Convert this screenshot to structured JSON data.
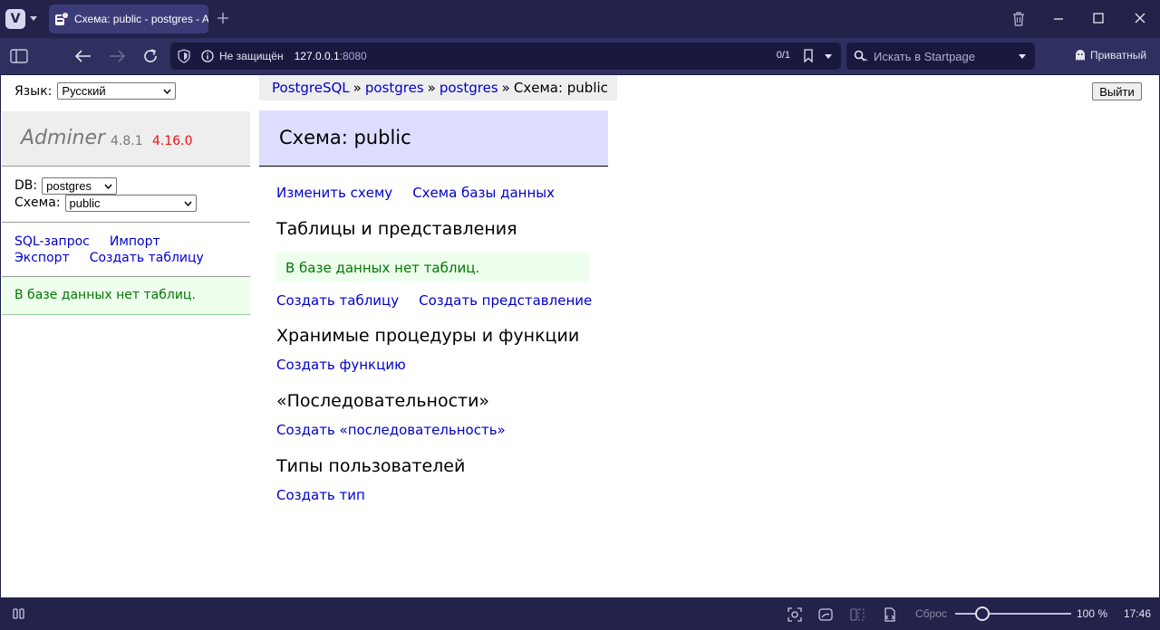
{
  "browser": {
    "tab_title": "Схема: public - postgres - Adminer",
    "address": {
      "security_label": "Не защищён",
      "host": "127.0.0.1",
      "port": ":8080",
      "match_counter": "0/1"
    },
    "search_placeholder": "Искать в Startpage",
    "private_label": "Приватный",
    "status": {
      "reset_label": "Сброс",
      "zoom": "100 %",
      "zoom_fraction": 0.2,
      "clock": "17:46"
    }
  },
  "sidebar": {
    "language_label": "Язык:",
    "language_value": "Русский",
    "logo": "Adminer",
    "version": "4.8.1",
    "new_version": "4.16.0",
    "db_label": "DB:",
    "db_value": "postgres",
    "schema_label": "Схема:",
    "schema_value": "public",
    "links": [
      "SQL-запрос",
      "Импорт",
      "Экспорт",
      "Создать таблицу"
    ],
    "message": "В базе данных нет таблиц."
  },
  "breadcrumb": {
    "items": [
      "PostgreSQL",
      "postgres",
      "postgres"
    ],
    "separator": "»",
    "current": "Схема: public"
  },
  "logout_label": "Выйти",
  "main": {
    "title": "Схема: public",
    "top_links": [
      "Изменить схему",
      "Схема базы данных"
    ],
    "tables_heading": "Таблицы и представления",
    "tables_message": "В базе данных нет таблиц.",
    "tables_links": [
      "Создать таблицу",
      "Создать представление"
    ],
    "routines_heading": "Хранимые процедуры и функции",
    "routines_link": "Создать функцию",
    "sequences_heading": "«Последовательности»",
    "sequences_link": "Создать «последовательность»",
    "types_heading": "Типы пользователей",
    "types_link": "Создать тип"
  },
  "colors": {
    "chrome_dark": "#22224a",
    "chrome_nav": "#2f2f60",
    "link": "#0000cc",
    "heading_bg": "#ddddff",
    "message_bg": "#eeffee",
    "message_text": "#007700",
    "new_version": "#ee1111"
  }
}
